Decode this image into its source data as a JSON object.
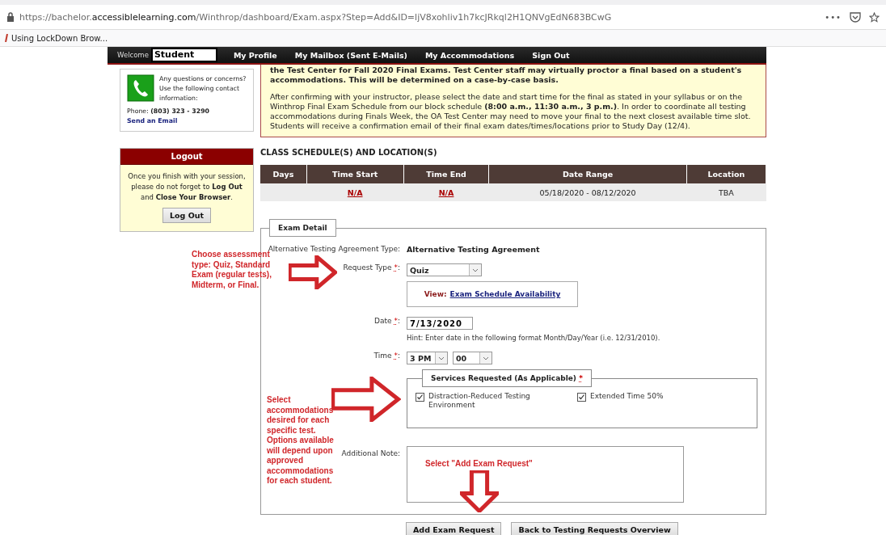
{
  "browser": {
    "url": {
      "prefix": "https://bachelor.",
      "domain": "accessiblelearning.com",
      "path": "/Winthrop/dashboard/Exam.aspx?Step=Add&ID=ljV8xohliv1h7kcJRkql2H1QNVgEdN683BCwG"
    },
    "menu_glyph": "•••",
    "bookmark": "Using LockDown Brow..."
  },
  "nav": {
    "welcome": "Welcome",
    "user": "Student",
    "links": [
      "My Profile",
      "My Mailbox (Sent E-Mails)",
      "My Accommodations",
      "Sign Out"
    ]
  },
  "sidebar": {
    "contact": {
      "text": "Any questions or concerns? Use the following contact information:",
      "phone": "Phone: **(803) 323 - 3290**",
      "email_link": "Send an Email"
    },
    "logout": {
      "title": "Logout",
      "text": "Once you finish with your session, please do not forget to **Log Out** and **Close Your Browser**.",
      "button": "Log Out"
    }
  },
  "notice": {
    "bold_text": "the Test Center for Fall 2020 Final Exams. Test Center staff may virtually proctor a final based on a student's accommodations. This will be determined on a case-by-case basis.",
    "paragraph": "After confirming with your instructor, please select the date and start time for the final as stated in your syllabus or on the Winthrop Final Exam Schedule from our block schedule **(8:00 a.m., 11:30 a.m., 3 p.m.)**. In order to coordinate all testing accommodations during Finals Week, the OA Test Center may need to move your final to the next closest available time slot. Students will receive a confirmation email of their final exam dates/times/locations prior to Study Day (12/4)."
  },
  "schedule": {
    "title": "CLASS SCHEDULE(S) AND LOCATION(S)",
    "columns": [
      "Days",
      "Time Start",
      "Time End",
      "Date Range",
      "Location"
    ],
    "rows": [
      [
        {
          "kind": "blank"
        },
        {
          "kind": "link",
          "text": "N/A"
        },
        {
          "kind": "link",
          "text": "N/A"
        },
        {
          "kind": "text",
          "text": "05/18/2020 - 08/12/2020"
        },
        {
          "kind": "text",
          "text": "TBA"
        }
      ]
    ]
  },
  "exam_detail": {
    "legend": "Exam Detail",
    "fields": [
      {
        "kind": "static",
        "label": "Alternative Testing Agreement Type:",
        "value": "Alternative Testing Agreement"
      },
      {
        "kind": "select",
        "label": "Request Type",
        "required_mark": "*",
        "label_end": ":",
        "value": "Quiz"
      },
      {
        "kind": "link_box",
        "prefix": "View:",
        "link": "Exam Schedule Availability"
      },
      {
        "kind": "date",
        "label": "Date",
        "required_mark": "*",
        "label_end": ":",
        "value": "7/13/2020",
        "hint": "Hint: Enter date in the following format Month/Day/Year (i.e. 12/31/2010)."
      },
      {
        "kind": "time",
        "label": "Time",
        "required_mark": "*",
        "label_end": ":",
        "hour": "3 PM",
        "minute": "00"
      },
      {
        "kind": "services",
        "legend": "Services Requested (As Applicable)",
        "required_mark": "*",
        "options": [
          {
            "label": "Distraction-Reduced Testing Environment",
            "checked": true
          },
          {
            "label": "Extended Time 50%",
            "checked": true
          }
        ]
      },
      {
        "kind": "textarea",
        "label": "Additional Note:"
      }
    ]
  },
  "buttons": [
    "Add Exam Request",
    "Back to Testing Requests Overview"
  ],
  "annotations": [
    {
      "text": "Choose assessment type: Quiz, Standard Exam (regular tests), Midterm, or Final.",
      "kind": "right_arrow"
    },
    {
      "text": "Select accommodations desired for each specific test. Options available will depend upon approved accommodations for each student.",
      "kind": "right_arrow"
    },
    {
      "text": "Select \"Add Exam Request\"",
      "kind": "down_arrow"
    }
  ]
}
